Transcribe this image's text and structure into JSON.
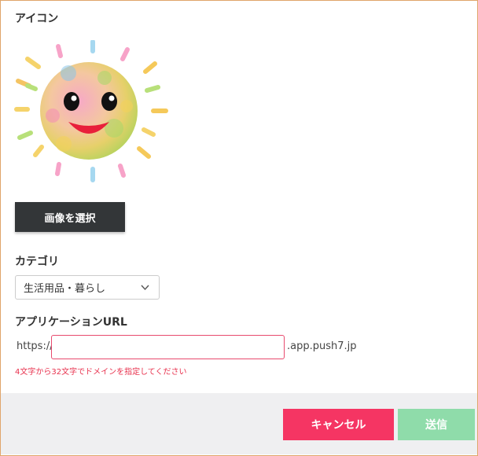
{
  "icon_section": {
    "label": "アイコン",
    "image": "smiling-sun-icon",
    "select_button": "画像を選択"
  },
  "category": {
    "label": "カテゴリ",
    "selected": "生活用品・暮らし",
    "icon": "chevron-down-icon"
  },
  "app_url": {
    "label": "アプリケーションURL",
    "prefix": "https://",
    "value": "",
    "suffix": ".app.push7.jp",
    "hint": "4文字から32文字でドメインを指定してください"
  },
  "footer": {
    "cancel": "キャンセル",
    "send": "送信"
  },
  "colors": {
    "cancel": "#f53563",
    "send": "#8fdcaa",
    "dark_button": "#333638",
    "error": "#e8324e"
  }
}
